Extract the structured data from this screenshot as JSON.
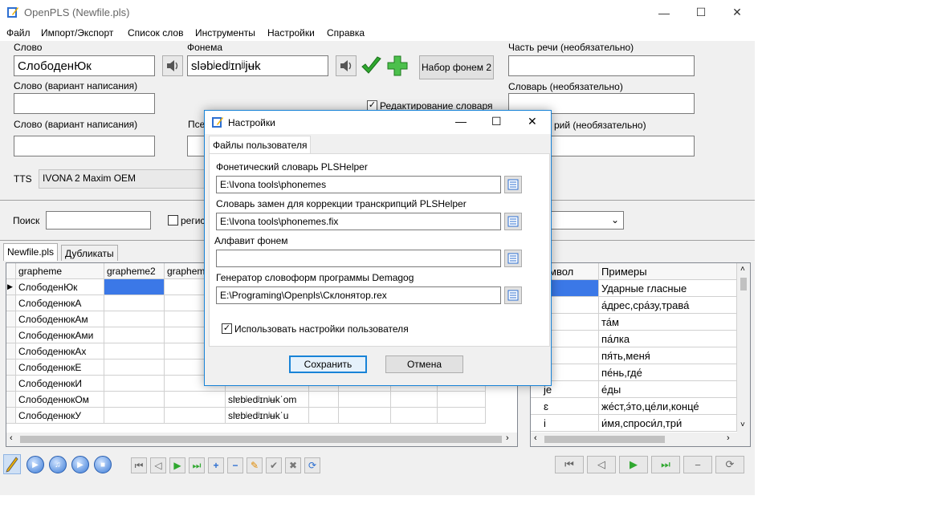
{
  "app": {
    "title": "OpenPLS (Newfile.pls)",
    "window_controls": {
      "minimize": "—",
      "maximize": "☐",
      "close": "✕"
    }
  },
  "menu": [
    "Файл",
    "Импорт/Экспорт",
    "Список слов",
    "Инструменты",
    "Настройки",
    "Справка"
  ],
  "form": {
    "word_label": "Слово",
    "word_value": "СлободенЮк",
    "phoneme_label": "Фонема",
    "phoneme_value": "sləbʲedʲɪnʲʲjʉk",
    "phoneme_set_button": "Набор фонем 2",
    "pos_label": "Часть речи (необязательно)",
    "pos_value": "",
    "variant1_label": "Слово (вариант написания)",
    "variant1_value": "",
    "dict_edit_label": "Редактирование словаря",
    "dictionary_label": "Словарь (необязательно)",
    "dictionary_value": "",
    "variant2_label": "Слово (вариант написания)",
    "variant2_value": "",
    "pseudo_label": "Псе",
    "comment_label": "рий (необязательно)",
    "comment_value": "",
    "tts_label": "TTS",
    "tts_value": "IVONA 2 Maxim OEM"
  },
  "search": {
    "label": "Поиск",
    "value": "",
    "case_label": "регис"
  },
  "tabs": [
    "Newfile.pls",
    "Дубликаты"
  ],
  "grid": {
    "columns": [
      "grapheme",
      "grapheme2",
      "graphem"
    ],
    "rows": [
      {
        "g": "СлободенЮк",
        "ph": ""
      },
      {
        "g": "СлободенюкА",
        "ph": ""
      },
      {
        "g": "СлободенюкАм",
        "ph": ""
      },
      {
        "g": "СлободенюкАми",
        "ph": ""
      },
      {
        "g": "СлободенюкАх",
        "ph": ""
      },
      {
        "g": "СлободенюкЕ",
        "ph": ""
      },
      {
        "g": "СлободенюкИ",
        "ph": ""
      },
      {
        "g": "СлободенюкОм",
        "ph": "slɐbʲedʲɪnʲʉkˈom"
      },
      {
        "g": "СлободенюкУ",
        "ph": "slɐbʲedʲɪnʲʉkˈu"
      }
    ]
  },
  "phon_table": {
    "columns": [
      "мвол",
      "Примеры"
    ],
    "rows": [
      {
        "sym": "",
        "ex": "Ударные гласные"
      },
      {
        "sym": "",
        "ex": "а́дрес,сра́зу,трава́"
      },
      {
        "sym": "",
        "ex": "та́м"
      },
      {
        "sym": "",
        "ex": "па́лка"
      },
      {
        "sym": "",
        "ex": "пя́ть,меня́"
      },
      {
        "sym": "",
        "ex": "пе́нь,где́"
      },
      {
        "sym": "je",
        "ex": "е́ды"
      },
      {
        "sym": "ɛ",
        "ex": "же́ст,э́то,це́ли,конце́"
      },
      {
        "sym": "i",
        "ex": "и́мя,спроси́л,три́"
      }
    ]
  },
  "dialog": {
    "title": "Настройки",
    "tab": "Файлы пользователя",
    "field1_label": "Фонетический словарь PLSHelper",
    "field1_value": "E:\\Ivona tools\\phonemes",
    "field2_label": "Словарь замен для коррекции транскрипций PLSHelper",
    "field2_value": "E:\\Ivona tools\\phonemes.fix",
    "field3_label": "Алфавит фонем",
    "field3_value": "",
    "field4_label": "Генератор словоформ программы Demagog",
    "field4_value": "E:\\Programing\\Openpls\\Склонятор.rex",
    "use_settings_label": "Использовать настройки пользователя",
    "save_button": "Сохранить",
    "cancel_button": "Отмена"
  },
  "colors": {
    "accent": "#1883d7",
    "selection": "#3b78e7",
    "check_green": "#2fa82f"
  }
}
